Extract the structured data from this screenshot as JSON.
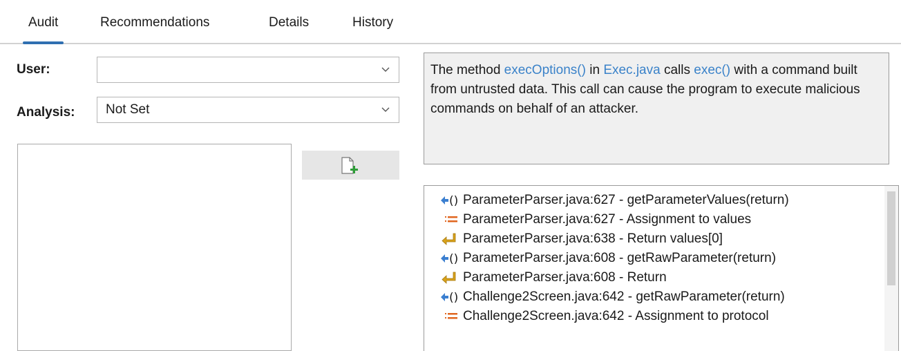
{
  "tabs": [
    {
      "label": "Audit",
      "active": true
    },
    {
      "label": "Recommendations",
      "active": false
    },
    {
      "label": "Details",
      "active": false
    },
    {
      "label": "History",
      "active": false
    }
  ],
  "form": {
    "user_label": "User:",
    "user_value": "",
    "analysis_label": "Analysis:",
    "analysis_value": "Not Set"
  },
  "comment": {
    "text": "",
    "add_icon": "add-file-icon"
  },
  "description": {
    "t1": "The method ",
    "method": "execOptions()",
    "t2": " in ",
    "file": "Exec.java",
    "t3": " calls ",
    "call": "exec()",
    "t4": " with a command built from untrusted data. This call can cause the program to execute malicious commands on behalf of an attacker."
  },
  "trace": [
    {
      "icon": "return-call-icon",
      "text": "ParameterParser.java:627 - getParameterValues(return)"
    },
    {
      "icon": "assignment-icon",
      "text": "ParameterParser.java:627 - Assignment to values"
    },
    {
      "icon": "return-icon",
      "text": "ParameterParser.java:638 - Return values[0]"
    },
    {
      "icon": "return-call-icon",
      "text": "ParameterParser.java:608 - getRawParameter(return)"
    },
    {
      "icon": "return-icon",
      "text": "ParameterParser.java:608 - Return"
    },
    {
      "icon": "return-call-icon",
      "text": "Challenge2Screen.java:642 - getRawParameter(return)"
    },
    {
      "icon": "assignment-icon",
      "text": "Challenge2Screen.java:642 - Assignment to protocol"
    }
  ],
  "colors": {
    "accent": "#2f6fb1",
    "link": "#3a82c9",
    "return_call_icon": "#3b7fd0",
    "assignment_icon": "#e0661f",
    "return_icon": "#d9a21a"
  }
}
